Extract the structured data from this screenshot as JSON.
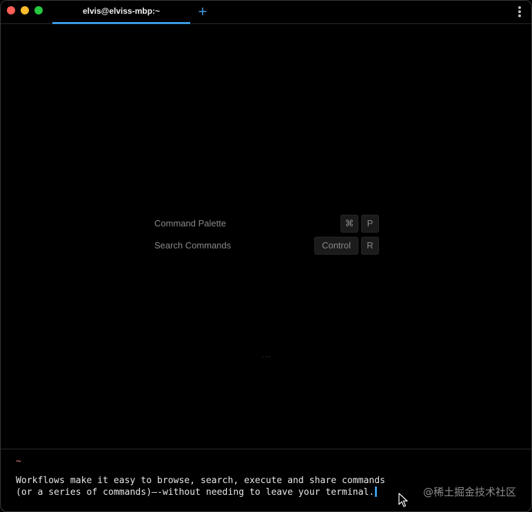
{
  "window": {
    "tab_title": "elvis@elviss-mbp:~",
    "new_tab_icon": "plus-icon",
    "menu_icon": "vertical-ellipsis-icon",
    "accent_color": "#3b9ae1"
  },
  "shortcuts": [
    {
      "label": "Command Palette",
      "keys": [
        "⌘",
        "P"
      ]
    },
    {
      "label": "Search Commands",
      "keys": [
        "Control",
        "R"
      ]
    }
  ],
  "blocks_ellipsis": "···",
  "input": {
    "prompt_dir": "~",
    "line1": "Workflows make it easy to browse, search, execute and share commands",
    "line2": "(or a series of commands)—-without needing to leave your terminal."
  },
  "watermark": "@稀土掘金技术社区"
}
